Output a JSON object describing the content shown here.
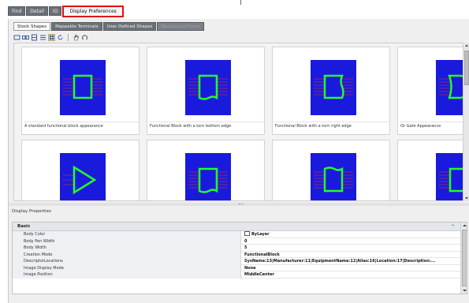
{
  "colors": {
    "highlight_box": "#e01010",
    "thumbnail_background": "#1a1add",
    "shape_outline": "#22ff22",
    "pin_color": "#cc3333"
  },
  "main_tabs": [
    {
      "label": "Find",
      "active": false
    },
    {
      "label": "Detail",
      "active": false
    },
    {
      "label": "IO",
      "active": false
    },
    {
      "label": "Display Preferences",
      "active": true
    }
  ],
  "sub_tabs": [
    {
      "label": "Stock Shapes",
      "active": true
    },
    {
      "label": "Mappable Terminals",
      "active": false
    },
    {
      "label": "User Defined Shapes",
      "active": false
    },
    {
      "label": "Mechanical Forms",
      "active": false,
      "disabled": true
    }
  ],
  "toolbar": {
    "buttons": [
      {
        "icon": "rectangle-icon"
      },
      {
        "icon": "link-shapes-icon"
      },
      {
        "icon": "columns-icon"
      },
      {
        "icon": "list-icon"
      },
      {
        "icon": "grid-icon",
        "checked": true
      },
      {
        "icon": "refresh-icon"
      },
      {
        "icon": "pan-hand-icon"
      },
      {
        "icon": "rotate-icon"
      }
    ]
  },
  "gallery": {
    "items": [
      {
        "caption": "A standard functional block appearance",
        "shape": "square"
      },
      {
        "caption": "Functional Block with a torn bottom edge",
        "shape": "torn-bottom"
      },
      {
        "caption": "Functional Block with a torn right edge",
        "shape": "torn-right"
      },
      {
        "caption": "Or Gate Appearance",
        "shape": "or-gate"
      },
      {
        "caption": "",
        "shape": "triangle"
      },
      {
        "caption": "",
        "shape": "torn-bottom"
      },
      {
        "caption": "",
        "shape": "torn-top"
      },
      {
        "caption": "",
        "shape": "square"
      }
    ]
  },
  "display_properties": {
    "title": "Display Properties",
    "category": "Basic",
    "rows": [
      {
        "name": "Body Color",
        "value": "ByLayer",
        "swatch": true
      },
      {
        "name": "Body Pen Width",
        "value": "0"
      },
      {
        "name": "Body Width",
        "value": "5"
      },
      {
        "name": "Creation Mode",
        "value": "FunctionalBlock"
      },
      {
        "name": "DescriptorLocations",
        "value": "SysName:13|Manufacturer:11|EquipmentName:12|Alias:16|Location:17|Description:..."
      },
      {
        "name": "Image Display Mode",
        "value": "None"
      },
      {
        "name": "Image Position",
        "value": "MiddleCenter"
      }
    ]
  }
}
